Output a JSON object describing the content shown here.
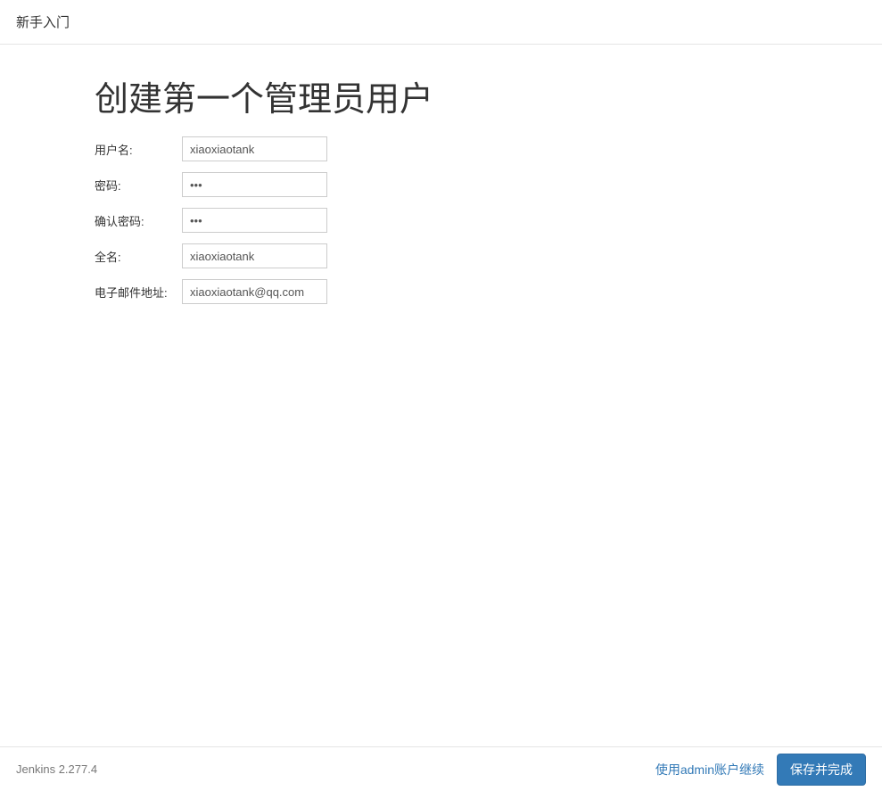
{
  "header": {
    "title": "新手入门"
  },
  "main": {
    "title": "创建第一个管理员用户",
    "form": {
      "username": {
        "label": "用户名:",
        "value": "xiaoxiaotank"
      },
      "password": {
        "label": "密码:",
        "value": "•••"
      },
      "confirm_password": {
        "label": "确认密码:",
        "value": "•••"
      },
      "fullname": {
        "label": "全名:",
        "value": "xiaoxiaotank"
      },
      "email": {
        "label": "电子邮件地址:",
        "value": "xiaoxiaotank@qq.com"
      }
    }
  },
  "footer": {
    "version": "Jenkins 2.277.4",
    "continue_as_admin": "使用admin账户继续",
    "save_and_finish": "保存并完成"
  }
}
